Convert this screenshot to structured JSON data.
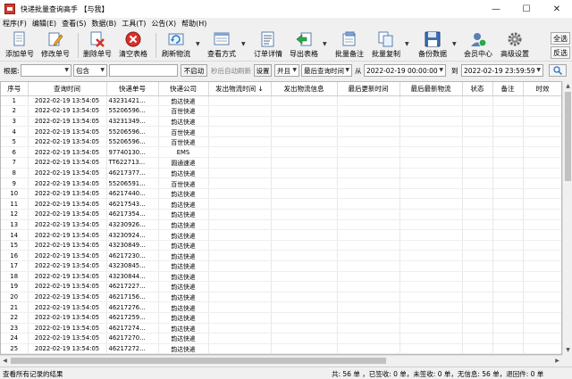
{
  "window": {
    "title": "快递批量查询高手 【与我】",
    "minimize": "—",
    "maximize": "☐",
    "close": "✕"
  },
  "menu": [
    "程序(F)",
    "编辑(E)",
    "查看(S)",
    "数据(B)",
    "工具(T)",
    "公告(X)",
    "帮助(H)"
  ],
  "toolbar": {
    "add": "添加单号",
    "edit": "修改单号",
    "delete": "删除单号",
    "clear": "清空表格",
    "refresh": "刷新物流",
    "view_mode": "查看方式",
    "order_detail": "订单详情",
    "export": "导出表格",
    "batch_note": "批量备注",
    "batch_copy": "批量复制",
    "backup": "备份数据",
    "member": "会员中心",
    "advanced": "高级设置",
    "select_all": "全选",
    "invert": "反选"
  },
  "filter": {
    "label_by": "根据:",
    "by_value": "",
    "match": "包含",
    "keyword": "",
    "auto_btn": "不启动",
    "auto_refresh": "秒后自动刷新",
    "settings": "设置",
    "logic": "并且",
    "time_field": "最后查询时间",
    "from_label": "从",
    "from_value": "2022-02-19 00:00:00",
    "to_label": "到",
    "to_value": "2022-02-19 23:59:59"
  },
  "table": {
    "columns": [
      "序号",
      "查询时间",
      "快递单号",
      "快递公司",
      "发出物流时间",
      "发出物流信息",
      "最后更新时间",
      "最后最新物流",
      "状态",
      "备注",
      "时效"
    ],
    "sort_indicator": "↓",
    "rows": [
      [
        "1",
        "2022-02-19 13:54:05",
        "43231421...",
        "韵达快递"
      ],
      [
        "2",
        "2022-02-19 13:54:05",
        "55206596...",
        "百世快递"
      ],
      [
        "3",
        "2022-02-19 13:54:05",
        "43231349...",
        "韵达快递"
      ],
      [
        "4",
        "2022-02-19 13:54:05",
        "55206596...",
        "百世快递"
      ],
      [
        "5",
        "2022-02-19 13:54:05",
        "55206596...",
        "百世快递"
      ],
      [
        "6",
        "2022-02-19 13:54:05",
        "97740130...",
        "EMS"
      ],
      [
        "7",
        "2022-02-19 13:54:05",
        "TT622713...",
        "圆通速递"
      ],
      [
        "8",
        "2022-02-19 13:54:05",
        "46217377...",
        "韵达快递"
      ],
      [
        "9",
        "2022-02-19 13:54:05",
        "55206591...",
        "百世快递"
      ],
      [
        "10",
        "2022-02-19 13:54:05",
        "46217440...",
        "韵达快递"
      ],
      [
        "11",
        "2022-02-19 13:54:05",
        "46217543...",
        "韵达快递"
      ],
      [
        "12",
        "2022-02-19 13:54:05",
        "46217354...",
        "韵达快递"
      ],
      [
        "13",
        "2022-02-19 13:54:05",
        "43230926...",
        "韵达快递"
      ],
      [
        "14",
        "2022-02-19 13:54:05",
        "43230924...",
        "韵达快递"
      ],
      [
        "15",
        "2022-02-19 13:54:05",
        "43230849...",
        "韵达快递"
      ],
      [
        "16",
        "2022-02-19 13:54:05",
        "46217230...",
        "韵达快递"
      ],
      [
        "17",
        "2022-02-19 13:54:05",
        "43230845...",
        "韵达快递"
      ],
      [
        "18",
        "2022-02-19 13:54:05",
        "43230844...",
        "韵达快递"
      ],
      [
        "19",
        "2022-02-19 13:54:05",
        "46217227...",
        "韵达快递"
      ],
      [
        "20",
        "2022-02-19 13:54:05",
        "46217156...",
        "韵达快递"
      ],
      [
        "21",
        "2022-02-19 13:54:05",
        "46217276...",
        "韵达快递"
      ],
      [
        "22",
        "2022-02-19 13:54:05",
        "46217259...",
        "韵达快递"
      ],
      [
        "23",
        "2022-02-19 13:54:05",
        "46217274...",
        "韵达快递"
      ],
      [
        "24",
        "2022-02-19 13:54:05",
        "46217270...",
        "韵达快递"
      ],
      [
        "25",
        "2022-02-19 13:54:05",
        "46217272...",
        "韵达快递"
      ]
    ]
  },
  "status": {
    "left": "查看所有记录的结果",
    "right": "共: 56 单 ，已签收: 0 单，未签收: 0 单，无信息: 56 单，退回件: 0 单"
  },
  "icons": {
    "add": "document-add-icon",
    "edit": "pencil-edit-icon",
    "delete": "delete-x-icon",
    "clear": "clear-red-circle-icon",
    "refresh": "refresh-icon",
    "view": "view-icon",
    "detail": "detail-icon",
    "export": "export-arrow-icon",
    "note": "note-icon",
    "copy": "copy-icon",
    "backup": "floppy-icon",
    "member": "member-icon",
    "advanced": "gear-icon"
  },
  "colors": {
    "accent_blue": "#2b73c8",
    "red": "#d9302c",
    "green": "#2aa84a"
  }
}
